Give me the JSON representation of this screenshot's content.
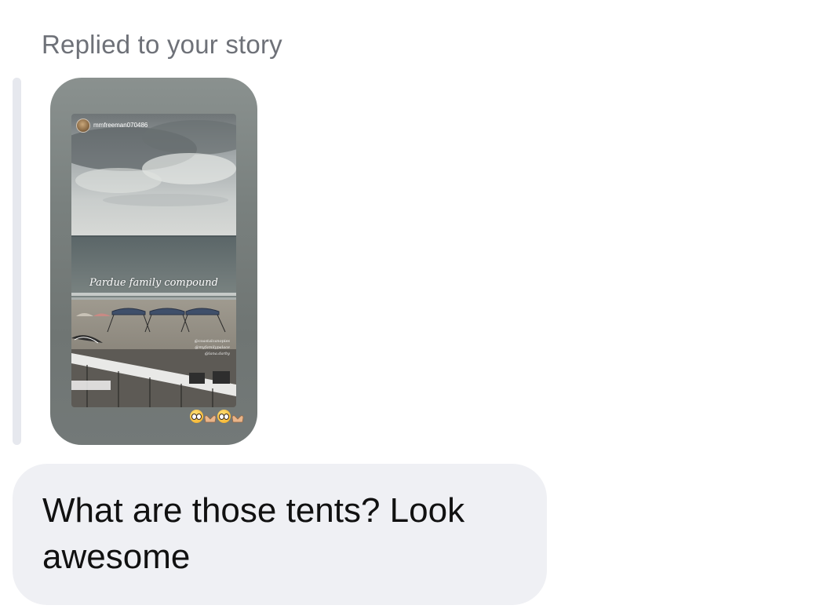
{
  "reply_context": {
    "label": "Replied to your story"
  },
  "story": {
    "username": "mmfreeman070486",
    "caption": "Pardue family compound",
    "tags": [
      "@coastalcanopies",
      "@myfamilypalace",
      "@lana.darby"
    ],
    "reaction_emojis": [
      "pleading-face",
      "heart-hands",
      "pleading-face",
      "heart-hands"
    ]
  },
  "message": {
    "text": "What are those tents? Look awesome"
  },
  "colors": {
    "bubble_background": "#eff0f4",
    "label_color": "#6e7178",
    "text_color": "#111111"
  }
}
